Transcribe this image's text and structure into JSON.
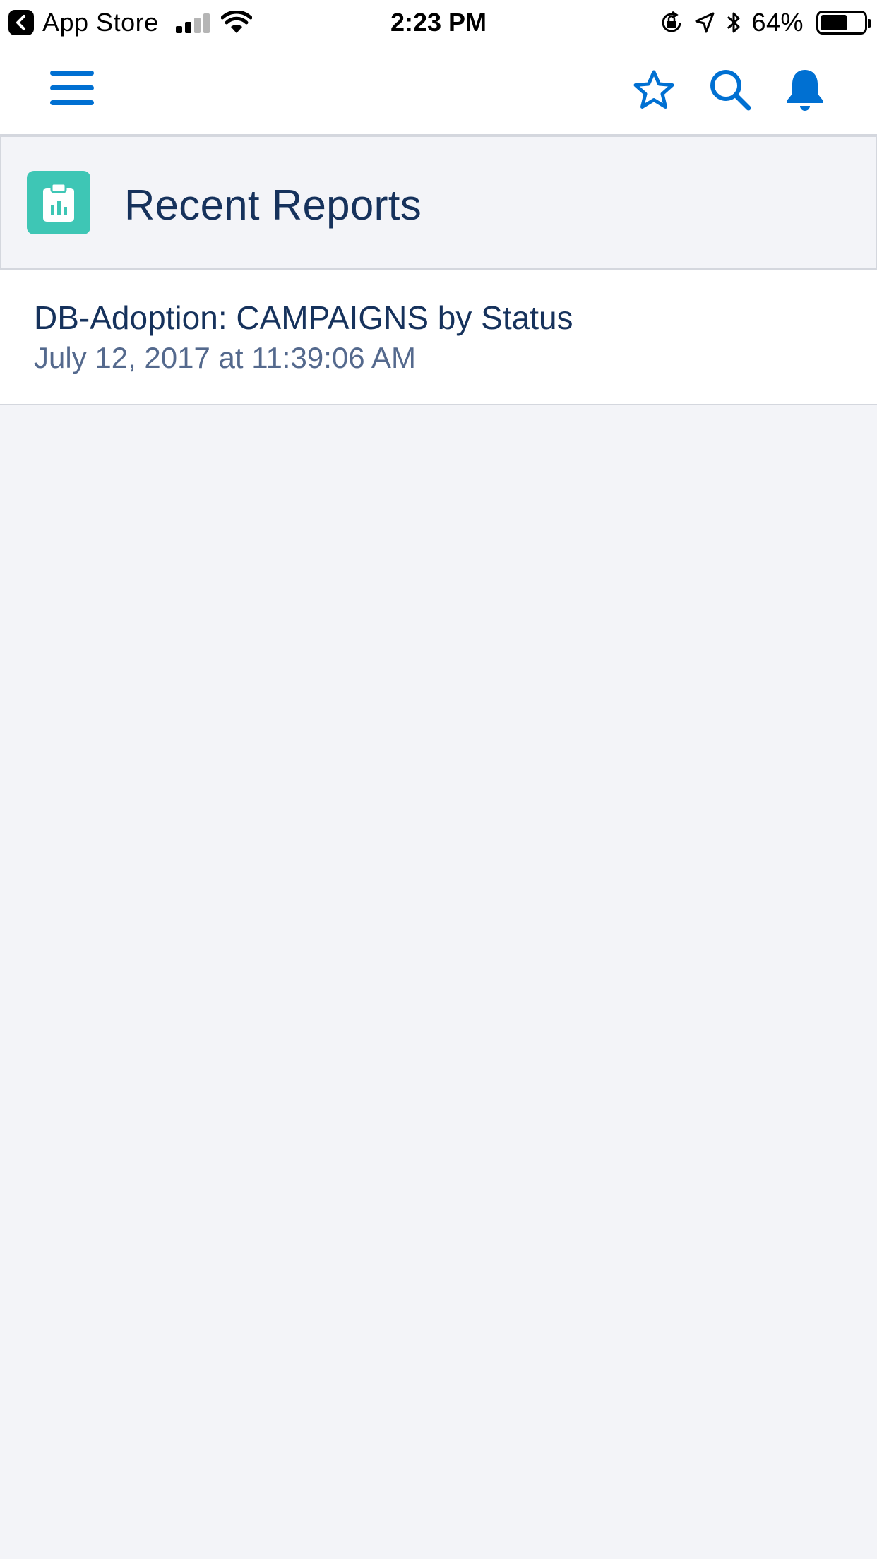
{
  "status_bar": {
    "back_label": "App Store",
    "time": "2:23 PM",
    "battery": "64%",
    "battery_level": 0.64
  },
  "nav": {
    "icons": [
      "menu-icon",
      "star-icon",
      "search-icon",
      "bell-icon"
    ],
    "accent_color": "#0070d2"
  },
  "header": {
    "title": "Recent Reports",
    "icon": "report-icon",
    "icon_color": "#3ec6b5"
  },
  "reports": [
    {
      "title": "DB-Adoption: CAMPAIGNS by Status",
      "date": "July 12, 2017 at 11:39:06 AM"
    }
  ]
}
